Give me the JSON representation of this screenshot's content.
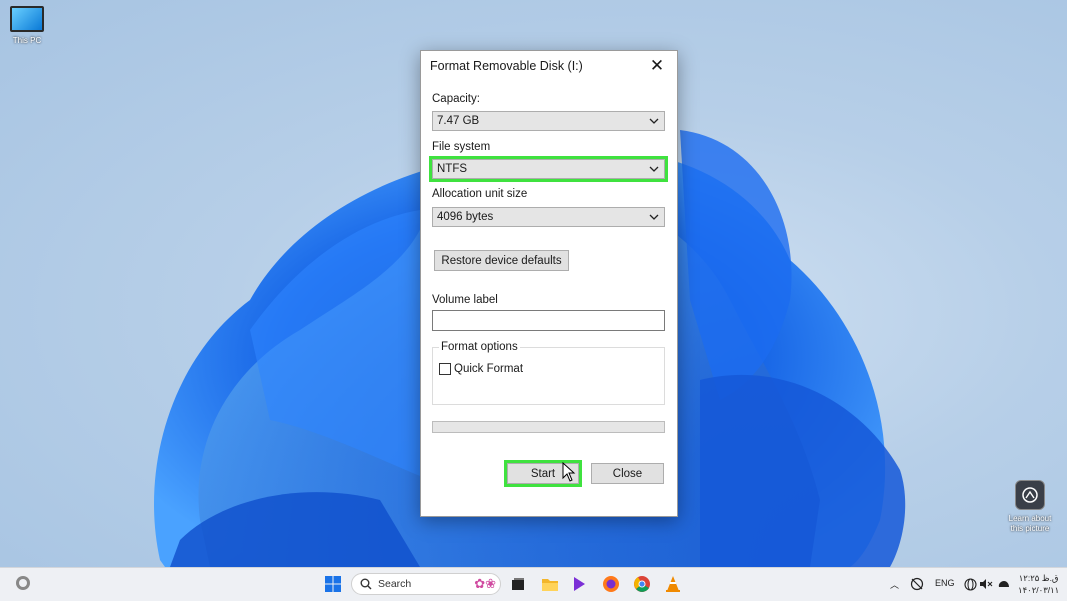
{
  "desktop": {
    "icon_this_pc": "This PC",
    "learn_about": "Learn about this picture"
  },
  "dialog": {
    "title": "Format Removable Disk (I:)",
    "capacity_label": "Capacity:",
    "capacity_value": "7.47 GB",
    "filesystem_label": "File system",
    "filesystem_value": "NTFS",
    "allocation_label": "Allocation unit size",
    "allocation_value": "4096 bytes",
    "restore_button": "Restore device defaults",
    "volume_label": "Volume label",
    "volume_value": "",
    "format_options_title": "Format options",
    "quick_format_label": "Quick Format",
    "quick_format_checked": false,
    "progress": 0,
    "start_button": "Start",
    "close_button": "Close",
    "highlight_color": "#3fe23f"
  },
  "taskbar": {
    "search_placeholder": "Search",
    "apps": [
      "windows-start-icon",
      "search-icon",
      "task-view-icon",
      "file-explorer-icon",
      "media-player-icon",
      "firefox-icon",
      "chrome-icon",
      "vlc-icon"
    ],
    "tray": {
      "language": "ENG",
      "time": "۱۲:۲۵ ق.ظ",
      "date": "۱۴۰۲/۰۳/۱۱"
    }
  }
}
